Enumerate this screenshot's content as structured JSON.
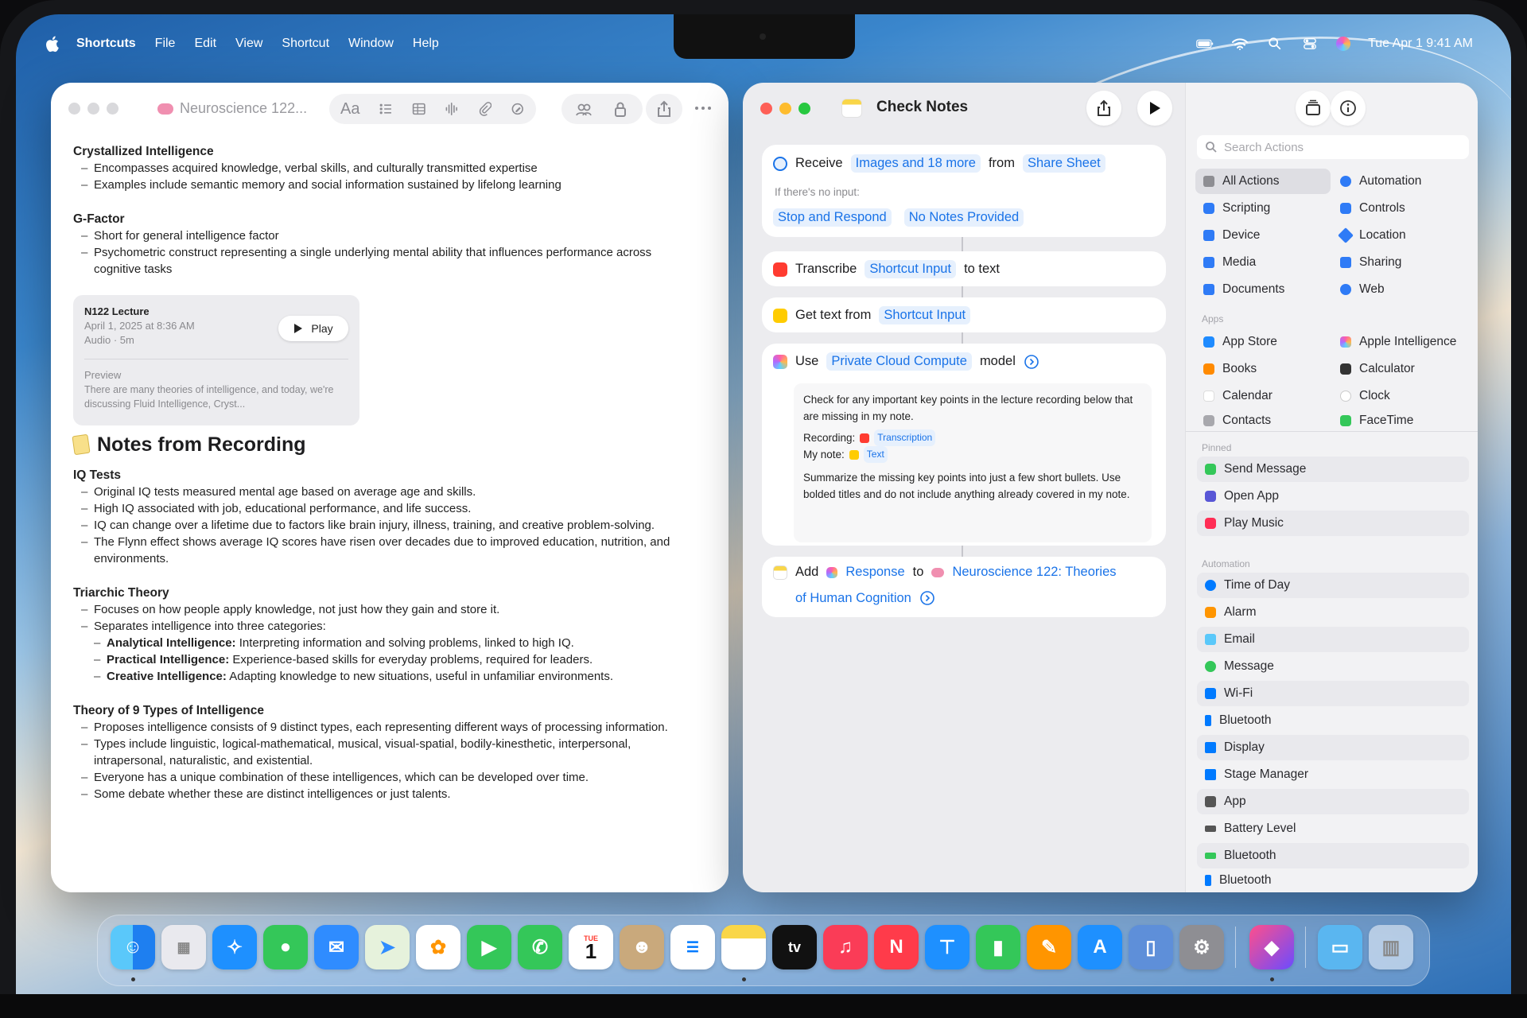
{
  "menubar": {
    "app_name": "Shortcuts",
    "menus": [
      "File",
      "Edit",
      "View",
      "Shortcut",
      "Window",
      "Help"
    ],
    "datetime": "Tue Apr 1  9:41 AM"
  },
  "notes": {
    "title": "Neuroscience 122...",
    "format_label": "Aa",
    "sections_top": [
      {
        "heading": "Crystallized Intelligence",
        "items": [
          "Encompasses acquired knowledge, verbal skills, and culturally transmitted expertise",
          "Examples include semantic memory and social information sustained by lifelong learning"
        ]
      },
      {
        "heading": "G-Factor",
        "items": [
          "Short for general intelligence factor",
          "Psychometric construct representing a single underlying mental ability that influences performance across cognitive tasks"
        ]
      }
    ],
    "audio": {
      "title": "N122 Lecture",
      "date": "April 1, 2025 at 8:36 AM",
      "meta": "Audio · 5m",
      "play_label": "Play",
      "preview_label": "Preview",
      "preview_text": "There are many theories of intelligence, and today, we're discussing Fluid Intelligence, Cryst..."
    },
    "recording_heading": "Notes from Recording",
    "iq": {
      "heading": "IQ Tests",
      "items": [
        "Original IQ tests measured mental age based on average age and skills.",
        "High IQ associated with job, educational performance, and life success.",
        "IQ can change over a lifetime due to factors like brain injury, illness, training, and creative problem-solving.",
        "The Flynn effect shows average IQ scores have risen over decades due to improved education, nutrition, and environments."
      ]
    },
    "triarchic": {
      "heading": "Triarchic Theory",
      "items": [
        "Focuses on how people apply knowledge, not just how they gain and store it.",
        "Separates intelligence into three categories:"
      ],
      "sub": [
        {
          "label": "Analytical Intelligence:",
          "text": " Interpreting information and solving problems, linked to high IQ."
        },
        {
          "label": "Practical Intelligence:",
          "text": " Experience-based skills for everyday problems, required for leaders."
        },
        {
          "label": "Creative Intelligence:",
          "text": " Adapting knowledge to new situations, useful in unfamiliar environments."
        }
      ]
    },
    "nine": {
      "heading": "Theory of 9 Types of Intelligence",
      "items": [
        "Proposes intelligence consists of 9 distinct types, each representing different ways of processing information.",
        "Types include linguistic, logical-mathematical, musical, visual-spatial, bodily-kinesthetic, interpersonal, intrapersonal, naturalistic, and existential.",
        "Everyone has a unique combination of these intelligences, which can be developed over time.",
        "Some debate whether these are distinct intelligences or just talents."
      ]
    }
  },
  "shortcuts": {
    "title": "Check Notes",
    "receive": {
      "verb": "Receive",
      "input": "Images and 18 more",
      "from": "from",
      "source": "Share Sheet",
      "no_input_label": "If there's no input:",
      "action": "Stop and Respond",
      "response": "No Notes Provided"
    },
    "transcribe": {
      "verb": "Transcribe",
      "input": "Shortcut Input",
      "suffix": "to text"
    },
    "gettext": {
      "verb": "Get text from",
      "input": "Shortcut Input"
    },
    "use": {
      "verb": "Use",
      "model": "Private Cloud Compute",
      "suffix": "model",
      "prompt1": "Check for any important key points in the lecture recording below that are missing in my note.",
      "recording_label": "Recording:",
      "recording_token": "Transcription",
      "note_label": "My note:",
      "note_token": "Text",
      "prompt2": "Summarize the missing key points into just a few short bullets. Use bolded titles and do not include anything already covered in my note."
    },
    "add": {
      "verb": "Add",
      "token": "Response",
      "to": "to",
      "target": "Neuroscience 122: Theories",
      "target2": "of Human Cognition"
    }
  },
  "sidebar": {
    "search_placeholder": "Search Actions",
    "categories_left": [
      "All Actions",
      "Scripting",
      "Device",
      "Media",
      "Documents"
    ],
    "categories_right": [
      "Automation",
      "Controls",
      "Location",
      "Sharing",
      "Web"
    ],
    "apps_label": "Apps",
    "apps_left": [
      "App Store",
      "Books",
      "Calendar",
      "Contacts"
    ],
    "apps_right": [
      "Apple Intelligence",
      "Calculator",
      "Clock",
      "FaceTime"
    ],
    "pinned_label": "Pinned",
    "pinned": [
      "Send Message",
      "Open App",
      "Play Music"
    ],
    "automation_label": "Automation",
    "automation": [
      "Time of Day",
      "Alarm",
      "Email",
      "Message",
      "Wi-Fi",
      "Bluetooth",
      "Display",
      "Stage Manager",
      "App",
      "Battery Level",
      "Bluetooth",
      "Bluetooth"
    ]
  },
  "dock": {
    "tv_label": "tv",
    "calendar_day": "1",
    "calendar_month": "TUE"
  },
  "colors": {
    "accent": "#1a73e8",
    "traffic_red": "#fe5f57",
    "traffic_yellow": "#febc2e",
    "traffic_green": "#28c840"
  }
}
